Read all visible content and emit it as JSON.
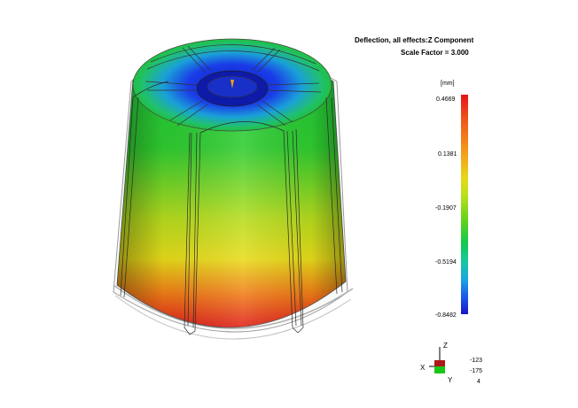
{
  "result": {
    "title": "Deflection, all effects:Z Component",
    "scale_label": "Scale Factor = 3.000"
  },
  "legend": {
    "unit": "[mm]",
    "ticks": [
      "0.4669",
      "0.1381",
      "-0.1907",
      "-0.5194",
      "-0.8482"
    ],
    "min": -0.8482,
    "max": 0.4669,
    "colors": [
      "#e8141a",
      "#f2a41a",
      "#e6d81a",
      "#5cd21e",
      "#18c8a0",
      "#1a5ae8",
      "#1a14c8"
    ]
  },
  "triad": {
    "x_label": "X",
    "y_label": "Y",
    "z_label": "Z",
    "coords": [
      "-123",
      "-175",
      "4"
    ]
  },
  "model": {
    "name": "part-deflection-contour",
    "colors": {
      "top": "#1a3ce0",
      "upper": "#20c040",
      "middle": "#d8e020",
      "bottom": "#e02818",
      "outline": "#7a7a7a"
    }
  }
}
